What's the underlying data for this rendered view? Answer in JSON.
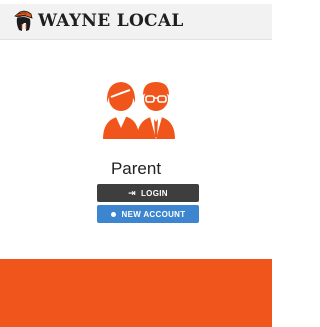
{
  "header": {
    "brand_name": "WAYNE LOCAL",
    "logo_icon": "spartan-helmet-icon"
  },
  "role_card": {
    "icon": "parent-users-icon",
    "label": "Parent",
    "login_label": "LOGIN",
    "login_icon": "login-icon",
    "new_account_label": "NEW ACCOUNT",
    "new_account_icon": "dot-icon"
  },
  "colors": {
    "accent": "#f0561c",
    "login_button": "#3e3e3e",
    "new_account_button": "#3d86cf"
  }
}
